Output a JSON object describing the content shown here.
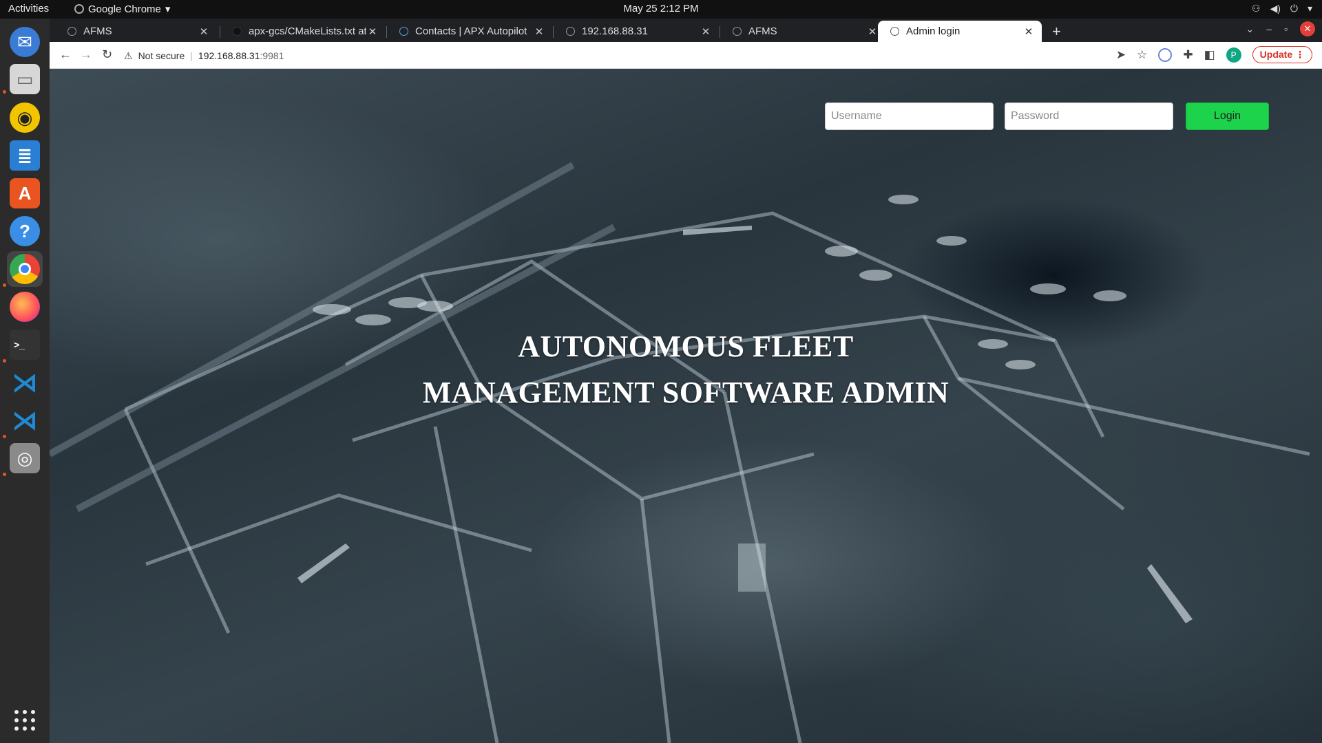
{
  "topbar": {
    "activities": "Activities",
    "app_name": "Google Chrome",
    "clock": "May 25  2:12 PM"
  },
  "dock": {
    "items": [
      {
        "icon": "thunderbird-icon",
        "color": "#3a7bd5"
      },
      {
        "icon": "files-icon",
        "color": "#d7d7d7"
      },
      {
        "icon": "rhythmbox-icon",
        "color": "#f2c500"
      },
      {
        "icon": "writer-icon",
        "color": "#2a7fd4"
      },
      {
        "icon": "software-center-icon",
        "color": "#e95420"
      },
      {
        "icon": "help-icon",
        "color": "#3a8ee6"
      },
      {
        "icon": "chrome-icon",
        "color": "#4285f4"
      },
      {
        "icon": "firefox-icon",
        "color": "#ff7139"
      },
      {
        "icon": "terminal-icon",
        "color": "#333333"
      },
      {
        "icon": "vscode-icon",
        "color": "#1f8ad2"
      },
      {
        "icon": "vscode-icon",
        "color": "#1f8ad2"
      },
      {
        "icon": "disk-icon",
        "color": "#8a8a8a"
      }
    ]
  },
  "tabs": [
    {
      "title": "AFMS",
      "active": false
    },
    {
      "title": "apx-gcs/CMakeLists.txt at",
      "active": false
    },
    {
      "title": "Contacts | APX Autopilot",
      "active": false
    },
    {
      "title": "192.168.88.31",
      "active": false
    },
    {
      "title": "AFMS",
      "active": false
    },
    {
      "title": "Admin login",
      "active": true
    }
  ],
  "address_bar": {
    "security": "Not secure",
    "host": "192.168.88.31",
    "port": ":9981"
  },
  "toolbar": {
    "profile_initial": "P",
    "update_label": "Update"
  },
  "login": {
    "username_placeholder": "Username",
    "password_placeholder": "Password",
    "button_label": "Login",
    "button_color": "#1ed34c"
  },
  "headline": {
    "line1": "AUTONOMOUS FLEET",
    "line2": "MANAGEMENT SOFTWARE ADMIN"
  }
}
